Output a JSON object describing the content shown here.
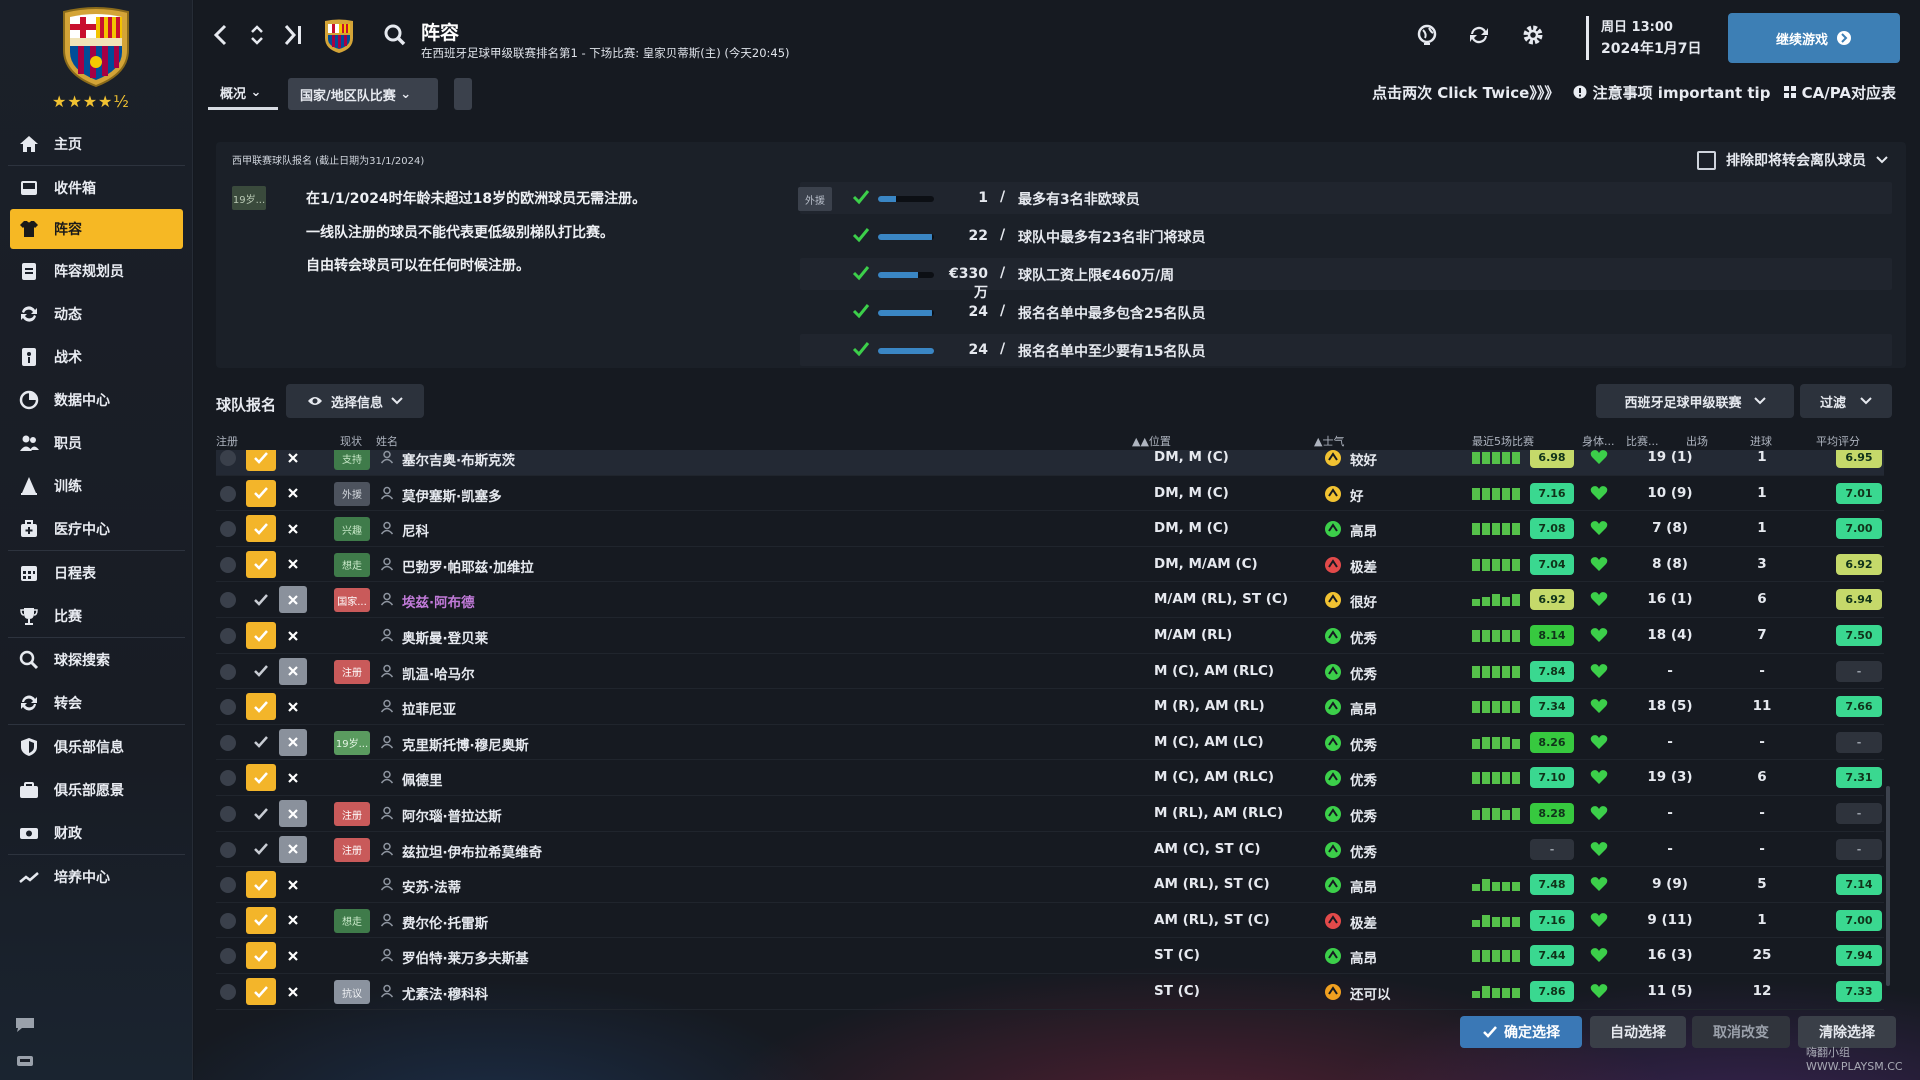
{
  "club": {
    "stars": "★★★★½"
  },
  "sidebar": {
    "items": [
      {
        "label": "主页",
        "icon": "home-icon"
      },
      {
        "label": "收件箱",
        "icon": "inbox-icon"
      },
      {
        "label": "阵容",
        "icon": "shirt-icon",
        "active": true
      },
      {
        "label": "阵容规划员",
        "icon": "clipboard-icon"
      },
      {
        "label": "动态",
        "icon": "dynamics-icon"
      },
      {
        "label": "战术",
        "icon": "tactics-icon"
      },
      {
        "label": "数据中心",
        "icon": "data-hub-icon"
      },
      {
        "label": "职员",
        "icon": "staff-icon"
      },
      {
        "label": "训练",
        "icon": "training-icon"
      },
      {
        "label": "医疗中心",
        "icon": "medical-icon"
      },
      {
        "label": "日程表",
        "icon": "calendar-icon"
      },
      {
        "label": "比赛",
        "icon": "trophy-icon"
      },
      {
        "label": "球探搜索",
        "icon": "search-icon"
      },
      {
        "label": "转会",
        "icon": "transfer-icon"
      },
      {
        "label": "俱乐部信息",
        "icon": "shield-icon"
      },
      {
        "label": "俱乐部愿景",
        "icon": "vision-icon"
      },
      {
        "label": "财政",
        "icon": "finance-icon"
      },
      {
        "label": "培养中心",
        "icon": "development-icon"
      }
    ]
  },
  "header": {
    "title": "阵容",
    "subtitle": "在西班牙足球甲级联赛排名第1 - 下场比赛: 皇家贝蒂斯(主) (今天20:45)",
    "date_line1": "周日 13:00",
    "date_line2": "2024年1月7日",
    "continue_label": "继续游戏"
  },
  "tabs": {
    "overview": "概况",
    "national": "国家/地区队比赛"
  },
  "top_links": {
    "click_twice": "点击两次 Click Twice》》》",
    "tip": "注意事项  important tip",
    "capa": "CA/PA对应表"
  },
  "registration": {
    "heading": "西甲联赛球队报名 (截止日期为31/1/2024)",
    "exclude_label": "排除即将转会离队球员",
    "age_badge": "19岁...",
    "rules": [
      "在1/1/2024时年龄未超过18岁的欧洲球员无需注册。",
      "一线队注册的球员不能代表更低级别梯队打比赛。",
      "自由转会球员可以在任何时候注册。"
    ],
    "requirements": [
      {
        "tag": "外援",
        "value": "1",
        "desc": "最多有3名非欧球员",
        "fill": 0.33
      },
      {
        "tag": "",
        "value": "22",
        "desc": "球队中最多有23名非门将球员",
        "fill": 0.96
      },
      {
        "tag": "",
        "value": "€330万",
        "desc": "球队工资上限€460万/周",
        "fill": 0.72
      },
      {
        "tag": "",
        "value": "24",
        "desc": "报名名单中最多包含25名队员",
        "fill": 0.96
      },
      {
        "tag": "",
        "value": "24",
        "desc": "报名名单中至少要有15名队员",
        "fill": 1.0
      }
    ]
  },
  "table": {
    "section_title": "球队报名",
    "select_info": "选择信息",
    "league_dropdown": "西班牙足球甲级联赛",
    "filter": "过滤",
    "headers": {
      "reg": "注册",
      "status": "现状",
      "name": "姓名",
      "pos": "▲▲位置",
      "morale": "▲士气",
      "recent": "最近5场比赛",
      "fitness": "身体...",
      "match": "比赛...",
      "apps": "出场",
      "goals": "进球",
      "avg": "平均评分"
    },
    "rows": [
      {
        "yes": true,
        "status": "支持",
        "status_style": "st-green",
        "name": "塞尔吉奥·布斯克茨",
        "pos": "DM, M (C)",
        "mood": "较好",
        "mood_type": "yellow",
        "bars": [
          5,
          5,
          5,
          5,
          5
        ],
        "recent": "6.98",
        "recent_color": "#c5d96a",
        "apps": "19 (1)",
        "goals": "1",
        "avg": "6.95",
        "avg_color": "#c5d96a"
      },
      {
        "yes": true,
        "status": "外援",
        "status_style": "st-grey",
        "name": "莫伊塞斯·凯塞多",
        "pos": "DM, M (C)",
        "mood": "好",
        "mood_type": "yellow",
        "bars": [
          5,
          5,
          5,
          5,
          5
        ],
        "recent": "7.16",
        "recent_color": "#3ad890",
        "apps": "10 (9)",
        "goals": "1",
        "avg": "7.01",
        "avg_color": "#3ad890"
      },
      {
        "yes": true,
        "status": "兴趣",
        "status_style": "st-green",
        "name": "尼科",
        "pos": "DM, M (C)",
        "mood": "高昂",
        "mood_type": "green",
        "bars": [
          5,
          5,
          5,
          5,
          5
        ],
        "recent": "7.08",
        "recent_color": "#3ad890",
        "apps": "7 (8)",
        "goals": "1",
        "avg": "7.00",
        "avg_color": "#3ad890"
      },
      {
        "yes": true,
        "status": "想走",
        "status_style": "st-green",
        "name": "巴勃罗·帕耶兹·加维拉",
        "pos": "DM, M/AM (C)",
        "mood": "极差",
        "mood_type": "red",
        "bars": [
          5,
          5,
          5,
          5,
          5
        ],
        "recent": "7.04",
        "recent_color": "#3ad890",
        "apps": "8 (8)",
        "goals": "3",
        "avg": "6.92",
        "avg_color": "#c5d96a"
      },
      {
        "yes": false,
        "status": "国家...",
        "status_style": "st-red",
        "name": "埃兹·阿布德",
        "name_purple": true,
        "pos": "M/AM (RL), ST (C)",
        "mood": "很好",
        "mood_type": "yellow",
        "bars": [
          3,
          4,
          5,
          4,
          5
        ],
        "recent": "6.92",
        "recent_color": "#c5d96a",
        "apps": "16 (1)",
        "goals": "6",
        "avg": "6.94",
        "avg_color": "#c5d96a"
      },
      {
        "yes": true,
        "status": "",
        "status_style": "",
        "name": "奥斯曼·登贝莱",
        "pos": "M/AM (RL)",
        "mood": "优秀",
        "mood_type": "green",
        "bars": [
          5,
          5,
          5,
          5,
          5
        ],
        "recent": "8.14",
        "recent_color": "#37c93f",
        "apps": "18 (4)",
        "goals": "7",
        "avg": "7.50",
        "avg_color": "#3ad890"
      },
      {
        "yes": false,
        "status": "注册",
        "status_style": "st-red",
        "name": "凯温·哈马尔",
        "pos": "M (C), AM (RLC)",
        "mood": "优秀",
        "mood_type": "green",
        "bars": [
          5,
          5,
          5,
          5,
          5
        ],
        "recent": "7.84",
        "recent_color": "#3ad890",
        "apps": "-",
        "goals": "-",
        "avg": "-",
        "avg_color": "#2e333c"
      },
      {
        "yes": true,
        "status": "",
        "status_style": "",
        "name": "拉菲尼亚",
        "pos": "M (R), AM (RL)",
        "mood": "高昂",
        "mood_type": "green",
        "bars": [
          5,
          5,
          5,
          5,
          5
        ],
        "recent": "7.34",
        "recent_color": "#3ad890",
        "apps": "18 (5)",
        "goals": "11",
        "avg": "7.66",
        "avg_color": "#3ad890"
      },
      {
        "yes": false,
        "status": "19岁...",
        "status_style": "st-lgreen",
        "name": "克里斯托博·穆尼奥斯",
        "pos": "M (C), AM (LC)",
        "mood": "优秀",
        "mood_type": "green",
        "bars": [
          4,
          5,
          5,
          5,
          4
        ],
        "recent": "8.26",
        "recent_color": "#37c93f",
        "apps": "-",
        "goals": "-",
        "avg": "-",
        "avg_color": "#2e333c"
      },
      {
        "yes": true,
        "status": "",
        "status_style": "",
        "name": "佩德里",
        "pos": "M (C), AM (RLC)",
        "mood": "优秀",
        "mood_type": "green",
        "bars": [
          5,
          5,
          5,
          5,
          5
        ],
        "recent": "7.10",
        "recent_color": "#3ad890",
        "apps": "19 (3)",
        "goals": "6",
        "avg": "7.31",
        "avg_color": "#3ad890"
      },
      {
        "yes": false,
        "status": "注册",
        "status_style": "st-red",
        "name": "阿尔瑙·普拉达斯",
        "pos": "M (RL), AM (RLC)",
        "mood": "优秀",
        "mood_type": "green",
        "bars": [
          4,
          5,
          5,
          4,
          5
        ],
        "recent": "8.28",
        "recent_color": "#37c93f",
        "apps": "-",
        "goals": "-",
        "avg": "-",
        "avg_color": "#2e333c"
      },
      {
        "yes": false,
        "status": "注册",
        "status_style": "st-red",
        "name": "兹拉坦·伊布拉希莫维奇",
        "pos": "AM (C), ST (C)",
        "mood": "优秀",
        "mood_type": "green",
        "bars": [],
        "recent": "-",
        "recent_color": "#2e333c",
        "apps": "-",
        "goals": "-",
        "avg": "-",
        "avg_color": "#2e333c"
      },
      {
        "yes": true,
        "status": "",
        "status_style": "",
        "name": "安苏·法蒂",
        "pos": "AM (RL), ST (C)",
        "mood": "高昂",
        "mood_type": "green",
        "bars": [
          3,
          5,
          4,
          4,
          4
        ],
        "recent": "7.48",
        "recent_color": "#3ad890",
        "apps": "9 (9)",
        "goals": "5",
        "avg": "7.14",
        "avg_color": "#3ad890"
      },
      {
        "yes": true,
        "status": "想走",
        "status_style": "st-green",
        "name": "费尔伦·托雷斯",
        "pos": "AM (RL), ST (C)",
        "mood": "极差",
        "mood_type": "red",
        "bars": [
          3,
          5,
          4,
          4,
          4
        ],
        "recent": "7.16",
        "recent_color": "#3ad890",
        "apps": "9 (11)",
        "goals": "1",
        "avg": "7.00",
        "avg_color": "#3ad890"
      },
      {
        "yes": true,
        "status": "",
        "status_style": "",
        "name": "罗伯特·莱万多夫斯基",
        "pos": "ST (C)",
        "mood": "高昂",
        "mood_type": "green",
        "bars": [
          5,
          5,
          5,
          5,
          5
        ],
        "recent": "7.44",
        "recent_color": "#3ad890",
        "apps": "16 (3)",
        "goals": "25",
        "avg": "7.94",
        "avg_color": "#3ad890"
      },
      {
        "yes": true,
        "status": "抗议",
        "status_style": "st-lgrey",
        "name": "尤素法·穆科科",
        "pos": "ST (C)",
        "mood": "还可以",
        "mood_type": "orange",
        "bars": [
          3,
          5,
          4,
          4,
          4
        ],
        "recent": "7.86",
        "recent_color": "#3ad890",
        "apps": "11 (5)",
        "goals": "12",
        "avg": "7.33",
        "avg_color": "#3ad890"
      }
    ]
  },
  "buttons": {
    "confirm": "确定选择",
    "auto": "自动选择",
    "cancel": "取消改变",
    "clear": "清除选择"
  },
  "watermark": "嗨翻小组 WWW.PLAYSM.CC",
  "colors": {
    "accent": "#f6b824",
    "blue": "#3a78b6"
  }
}
